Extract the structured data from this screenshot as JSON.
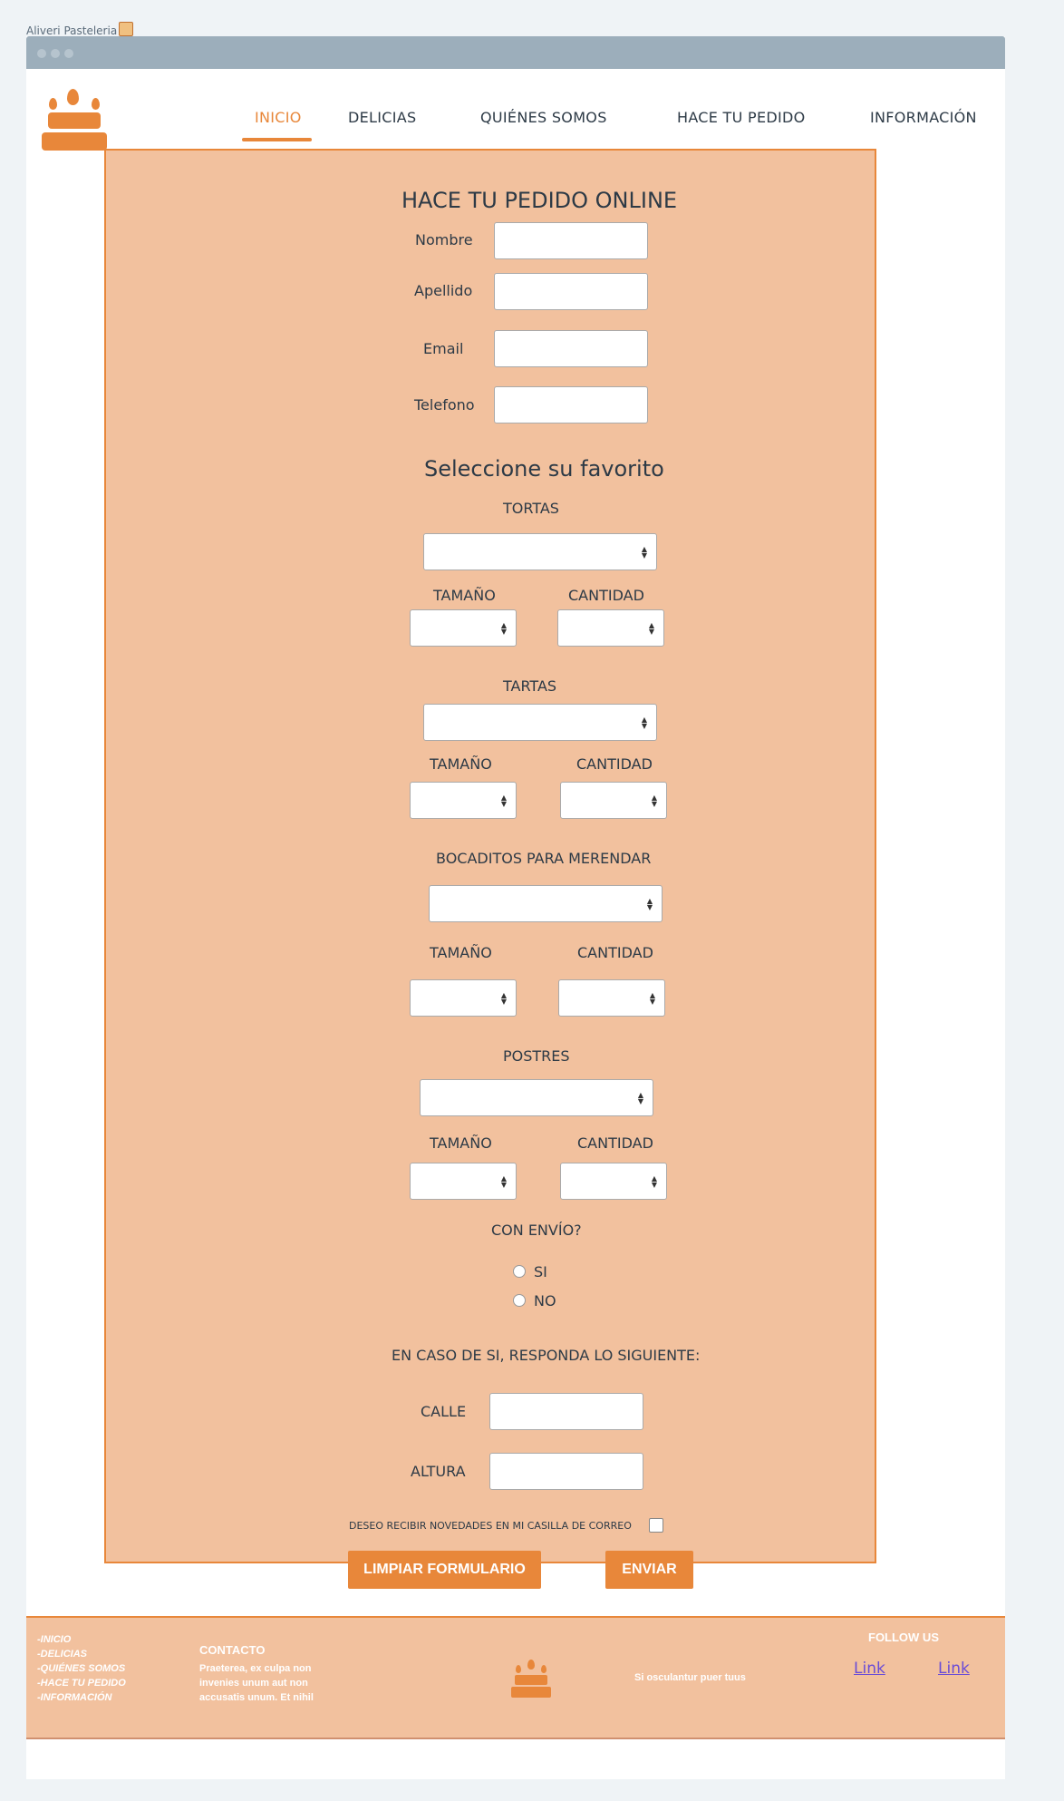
{
  "tab": {
    "title": "Aliveri Pasteleria"
  },
  "nav": {
    "items": [
      {
        "label": "INICIO"
      },
      {
        "label": "DELICIAS"
      },
      {
        "label": "QUIÉNES SOMOS"
      },
      {
        "label": "HACE TU PEDIDO"
      },
      {
        "label": "INFORMACIÓN"
      }
    ],
    "active_index": 0
  },
  "form": {
    "title": "HACE TU PEDIDO ONLINE",
    "fields": {
      "nombre": {
        "label": "Nombre",
        "value": ""
      },
      "apellido": {
        "label": "Apellido",
        "value": ""
      },
      "email": {
        "label": "Email",
        "value": ""
      },
      "telefono": {
        "label": "Telefono",
        "value": ""
      }
    },
    "favorites_title": "Seleccione su favorito",
    "sections": [
      {
        "label": "TORTAS",
        "size_label": "TAMAÑO",
        "qty_label": "CANTIDAD"
      },
      {
        "label": "TARTAS",
        "size_label": "TAMAÑO",
        "qty_label": "CANTIDAD"
      },
      {
        "label": "BOCADITOS PARA MERENDAR",
        "size_label": "TAMAÑO",
        "qty_label": "CANTIDAD"
      },
      {
        "label": "POSTRES",
        "size_label": "TAMAÑO",
        "qty_label": "CANTIDAD"
      }
    ],
    "shipping": {
      "question": "CON ENVÍO?",
      "options": [
        {
          "label": "SI"
        },
        {
          "label": "NO"
        }
      ],
      "if_yes": "EN CASO DE SI, RESPONDA LO SIGUIENTE:",
      "calle_label": "CALLE",
      "altura_label": "ALTURA"
    },
    "newsletter_label": "DESEO RECIBIR NOVEDADES EN MI CASILLA DE CORREO",
    "newsletter_checked": false,
    "clear_button": "LIMPIAR FORMULARIO",
    "submit_button": "ENVIAR"
  },
  "footer": {
    "nav": [
      "-INICIO",
      "-DELICIAS",
      "-QUIÉNES SOMOS",
      "-HACE TU PEDIDO",
      "-INFORMACIÓN"
    ],
    "contact_title": "CONTACTO",
    "contact_text": [
      "Praeterea, ex culpa non",
      "invenies unum aut non",
      "accusatis unum. Et nihil"
    ],
    "tagline": "Si osculantur puer tuus",
    "follow_title": "FOLLOW US",
    "links": [
      {
        "label": "Link"
      },
      {
        "label": "Link"
      }
    ]
  },
  "colors": {
    "accent": "#e8873a",
    "panel": "#f2c19e",
    "titlebar": "#9caebb",
    "link": "#6a4cd6"
  }
}
